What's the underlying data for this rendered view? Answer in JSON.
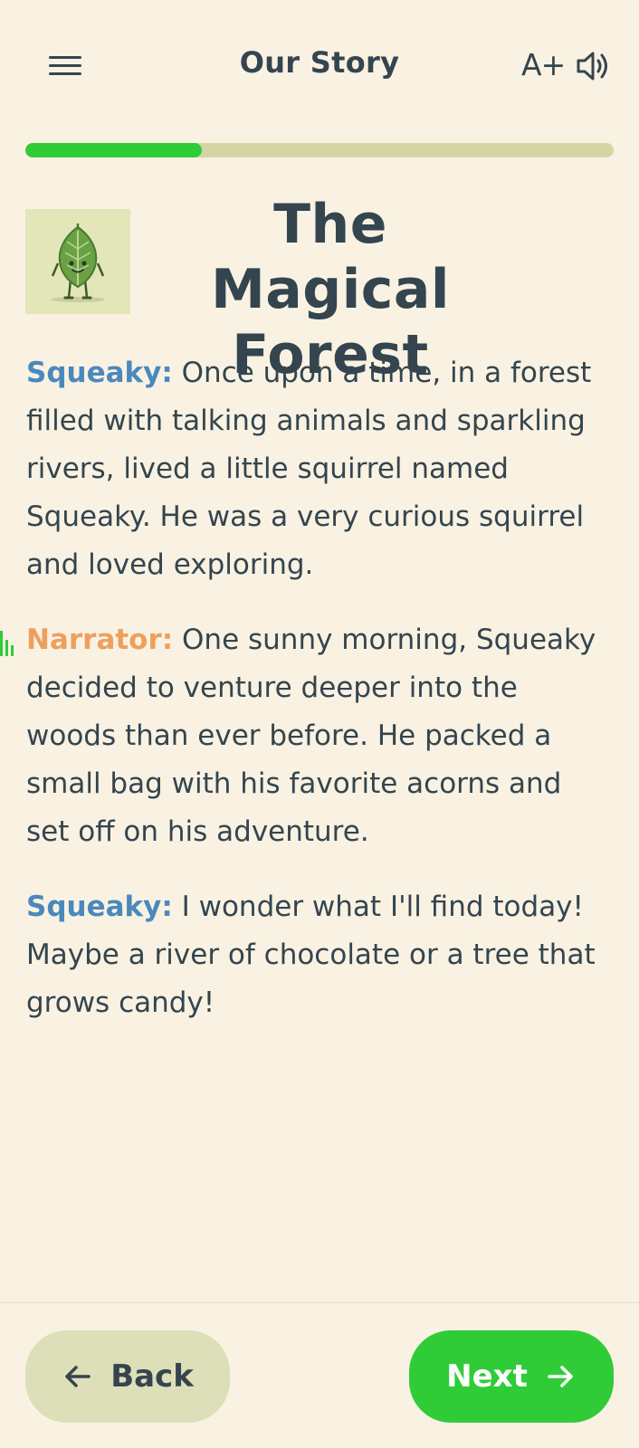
{
  "header": {
    "title": "Our Story",
    "font_size_label": "A+",
    "icons": [
      "menu-icon",
      "speaker-icon"
    ]
  },
  "progress": {
    "value_percent": 30
  },
  "story": {
    "title": "The Magical Forest",
    "thumbnail": "leaf-character",
    "paragraphs": [
      {
        "speaker": "Squeaky:",
        "text": " Once upon a time, in a forest filled with talking animals and sparkling rivers, lived a little squirrel named Squeaky. He was a very curious squirrel and loved exploring."
      },
      {
        "speaker": "Narrator:",
        "text": " One sunny morning, Squeaky decided to venture deeper into the woods than ever before. He packed a small bag with his favorite acorns and set off on his adventure."
      },
      {
        "speaker": "Squeaky:",
        "text": " I wonder what I'll find today! Maybe a river of chocolate or a tree that grows candy!"
      }
    ]
  },
  "footer": {
    "back_label": "Back",
    "next_label": "Next"
  },
  "colors": {
    "background": "#f9f2e2",
    "accent_green": "#30cc38",
    "squeaky_blue": "#4a88bd",
    "narrator_orange": "#eda05e",
    "text": "#34454f"
  }
}
